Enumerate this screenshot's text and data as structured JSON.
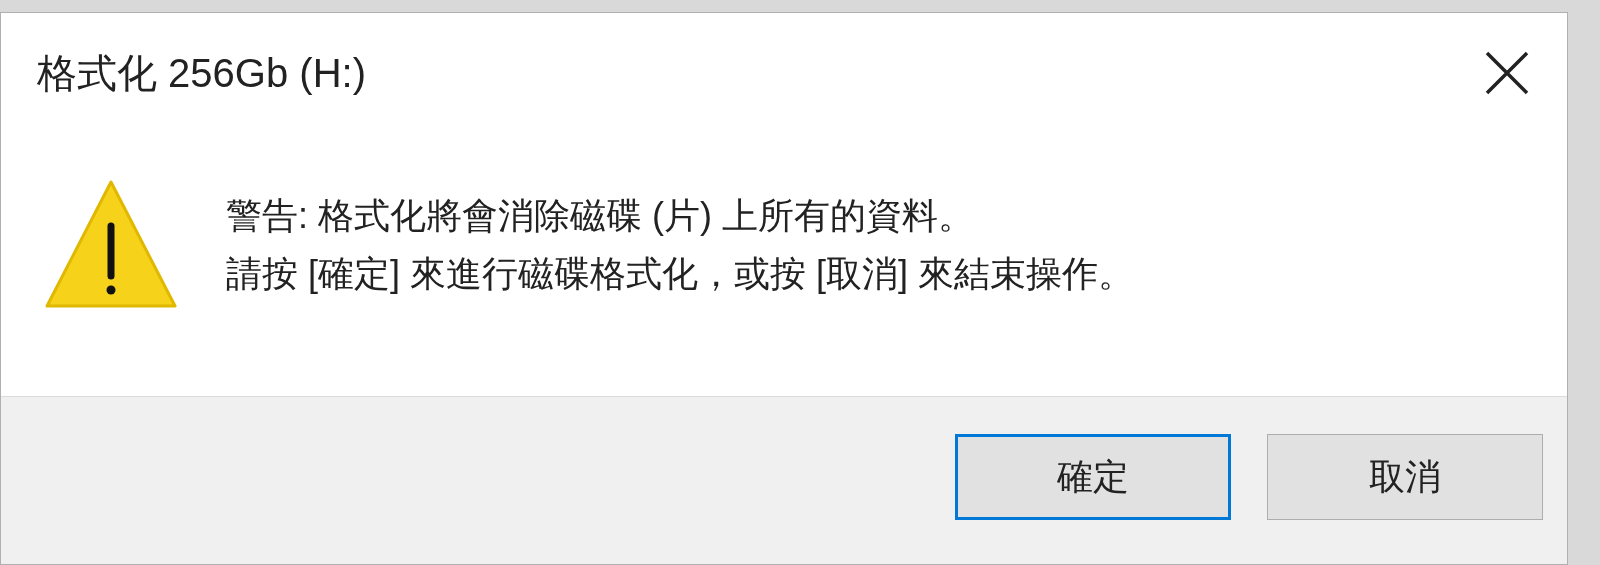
{
  "window": {
    "title": "格式化 256Gb (H:)"
  },
  "message": [
    "警告: 格式化將會消除磁碟 (片) 上所有的資料。",
    "請按 [確定] 來進行磁碟格式化，或按 [取消] 來結束操作。"
  ],
  "buttons": [
    {
      "label": "確定",
      "selected": true
    },
    {
      "label": "取消",
      "selected": false
    }
  ]
}
